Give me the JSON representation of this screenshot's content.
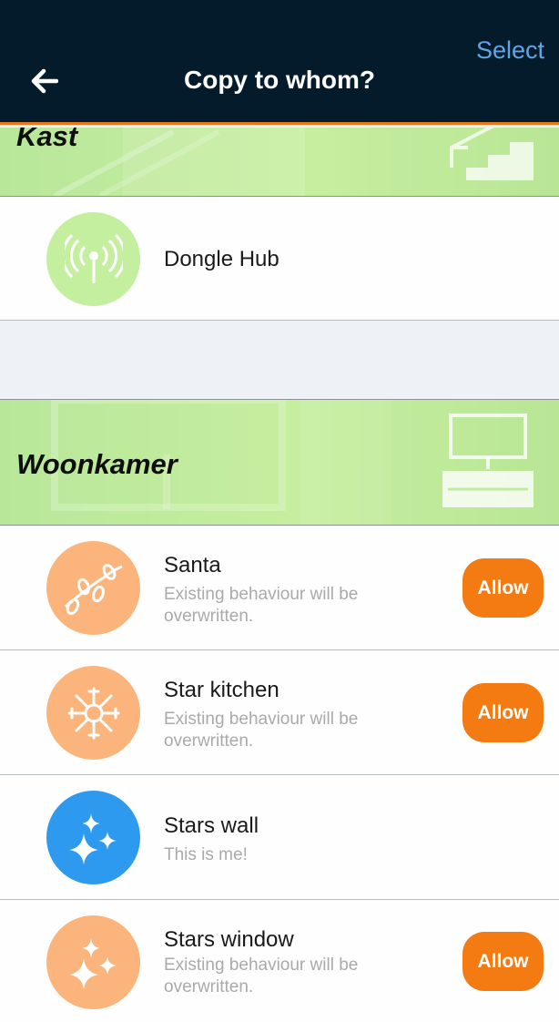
{
  "header": {
    "title": "Copy to whom?",
    "select_label": "Select",
    "back_icon": "arrow-left-icon"
  },
  "colors": {
    "header_bg": "#031b2a",
    "accent": "#f47a12",
    "select_blue": "#5ea6e8",
    "section_green": "#c1eb9c",
    "avatar_orange": "#fbb47c",
    "avatar_green": "#c4ef9f",
    "avatar_blue": "#2d9af0"
  },
  "sections": [
    {
      "title": "Kast",
      "icon": "stairs-icon",
      "devices": [
        {
          "name": "Dongle Hub",
          "subtitle": "",
          "icon": "antenna-icon",
          "action": ""
        }
      ]
    },
    {
      "title": "Woonkamer",
      "icon": "tv-desk-icon",
      "devices": [
        {
          "name": "Santa",
          "subtitle": "Existing behaviour will be overwritten.",
          "icon": "string-lights-icon",
          "action": "Allow"
        },
        {
          "name": "Star kitchen",
          "subtitle": "Existing behaviour will be overwritten.",
          "icon": "snowflake-icon",
          "action": "Allow"
        },
        {
          "name": "Stars wall",
          "subtitle": "This is me!",
          "icon": "sparkles-icon",
          "action": ""
        },
        {
          "name": "Stars window",
          "subtitle": "Existing behaviour will be overwritten.",
          "icon": "sparkles-icon",
          "action": "Allow"
        }
      ]
    }
  ]
}
